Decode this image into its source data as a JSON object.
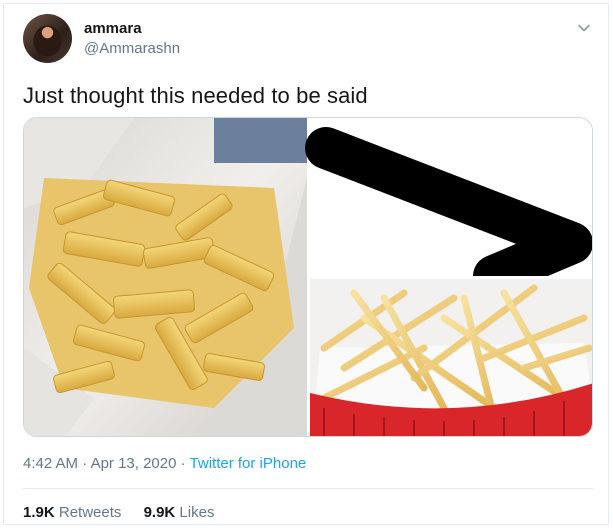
{
  "tweet": {
    "author_name": "ammara",
    "author_handle": "@Ammarashn",
    "text": "Just thought this needed to be said",
    "time": "4:42 AM",
    "separator1": " · ",
    "date": "Apr 13, 2020",
    "separator2": " · ",
    "source": "Twitter for iPhone",
    "retweets_count": "1.9K",
    "retweets_label": "Retweets",
    "likes_count": "9.9K",
    "likes_label": "Likes"
  },
  "colors": {
    "link": "#1da1f2",
    "secondary_text": "#657786",
    "border": "#e6ecf0"
  },
  "icons": {
    "menu": "chevron-down-icon"
  }
}
